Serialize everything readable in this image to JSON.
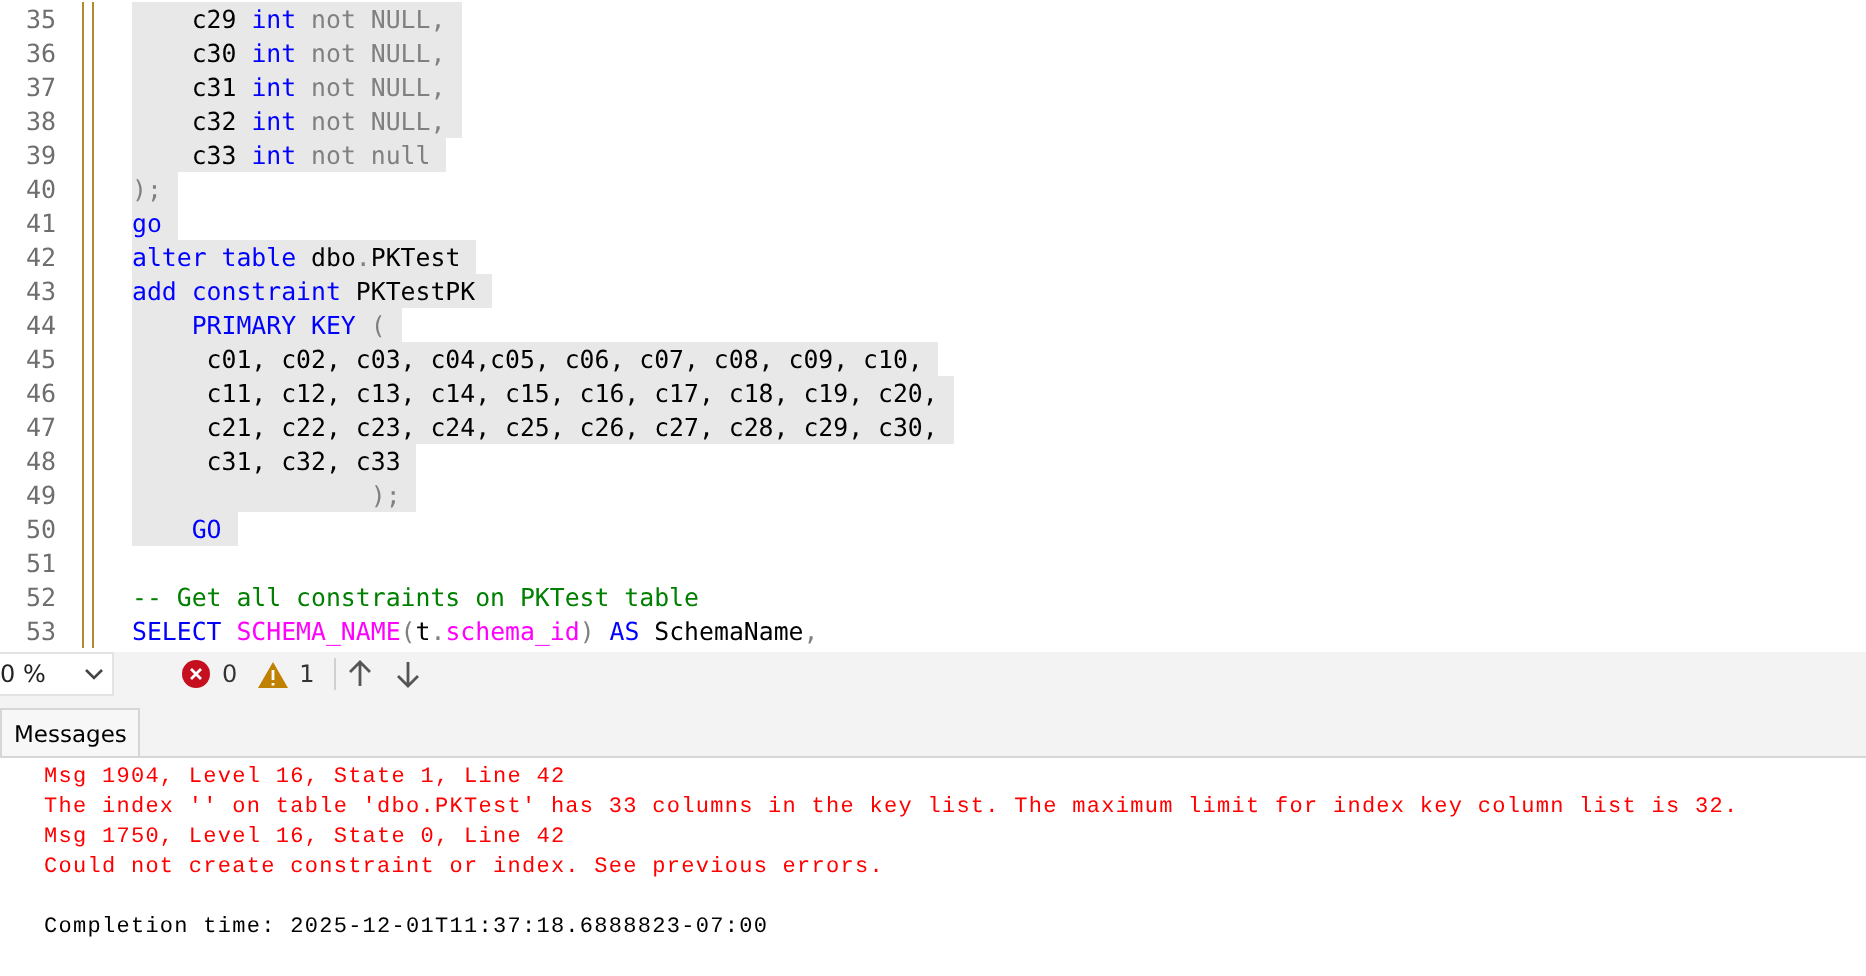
{
  "editor": {
    "lines": [
      {
        "number": "35",
        "selected": true,
        "tokens": [
          {
            "kind": "text",
            "text": "    c29 "
          },
          {
            "kind": "keyword",
            "text": "int"
          },
          {
            "kind": "gray",
            "text": " not NULL,"
          }
        ]
      },
      {
        "number": "36",
        "selected": true,
        "tokens": [
          {
            "kind": "text",
            "text": "    c30 "
          },
          {
            "kind": "keyword",
            "text": "int"
          },
          {
            "kind": "gray",
            "text": " not NULL,"
          }
        ]
      },
      {
        "number": "37",
        "selected": true,
        "tokens": [
          {
            "kind": "text",
            "text": "    c31 "
          },
          {
            "kind": "keyword",
            "text": "int"
          },
          {
            "kind": "gray",
            "text": " not NULL,"
          }
        ]
      },
      {
        "number": "38",
        "selected": true,
        "tokens": [
          {
            "kind": "text",
            "text": "    c32 "
          },
          {
            "kind": "keyword",
            "text": "int"
          },
          {
            "kind": "gray",
            "text": " not NULL,"
          }
        ]
      },
      {
        "number": "39",
        "selected": true,
        "tokens": [
          {
            "kind": "text",
            "text": "    c33 "
          },
          {
            "kind": "keyword",
            "text": "int"
          },
          {
            "kind": "gray",
            "text": " not null"
          }
        ]
      },
      {
        "number": "40",
        "selected": true,
        "tokens": [
          {
            "kind": "gray",
            "text": ");"
          }
        ]
      },
      {
        "number": "41",
        "selected": true,
        "tokens": [
          {
            "kind": "keyword",
            "text": "go"
          }
        ]
      },
      {
        "number": "42",
        "selected": true,
        "tokens": [
          {
            "kind": "keyword",
            "text": "alter table "
          },
          {
            "kind": "text",
            "text": "dbo"
          },
          {
            "kind": "gray",
            "text": "."
          },
          {
            "kind": "text",
            "text": "PKTest"
          }
        ]
      },
      {
        "number": "43",
        "selected": true,
        "tokens": [
          {
            "kind": "keyword",
            "text": "add constraint "
          },
          {
            "kind": "text",
            "text": "PKTestPK"
          }
        ]
      },
      {
        "number": "44",
        "selected": true,
        "tokens": [
          {
            "kind": "keyword",
            "text": "    PRIMARY KEY "
          },
          {
            "kind": "gray",
            "text": "("
          }
        ]
      },
      {
        "number": "45",
        "selected": true,
        "tokens": [
          {
            "kind": "text",
            "text": "     c01, c02, c03, c04,c05, c06, c07, c08, c09, c10,"
          }
        ]
      },
      {
        "number": "46",
        "selected": true,
        "tokens": [
          {
            "kind": "text",
            "text": "     c11, c12, c13, c14, c15, c16, c17, c18, c19, c20,"
          }
        ]
      },
      {
        "number": "47",
        "selected": true,
        "tokens": [
          {
            "kind": "text",
            "text": "     c21, c22, c23, c24, c25, c26, c27, c28, c29, c30,"
          }
        ]
      },
      {
        "number": "48",
        "selected": true,
        "tokens": [
          {
            "kind": "text",
            "text": "     c31, c32, c33"
          }
        ]
      },
      {
        "number": "49",
        "selected": true,
        "tokens": [
          {
            "kind": "gray",
            "text": "                );"
          }
        ]
      },
      {
        "number": "50",
        "selected": true,
        "tokens": [
          {
            "kind": "keyword",
            "text": "    GO"
          }
        ]
      },
      {
        "number": "51"
      },
      {
        "number": "52",
        "selected": false,
        "tokens": [
          {
            "kind": "comment",
            "text": "-- Get all constraints on PKTest table"
          }
        ]
      },
      {
        "number": "53",
        "selected": false,
        "tokens": [
          {
            "kind": "keyword",
            "text": "SELECT "
          },
          {
            "kind": "function",
            "text": "SCHEMA_NAME"
          },
          {
            "kind": "gray",
            "text": "("
          },
          {
            "kind": "text",
            "text": "t"
          },
          {
            "kind": "gray",
            "text": "."
          },
          {
            "kind": "function",
            "text": "schema_id"
          },
          {
            "kind": "gray",
            "text": ")"
          },
          {
            "kind": "keyword",
            "text": " AS "
          },
          {
            "kind": "text",
            "text": "SchemaName"
          },
          {
            "kind": "gray",
            "text": ","
          }
        ]
      }
    ]
  },
  "status_bar": {
    "zoom": "0 %",
    "errors": "0",
    "warnings": "1"
  },
  "tabs": [
    {
      "label": "Messages",
      "selected": true
    }
  ],
  "messages": [
    {
      "kind": "error",
      "text": "Msg 1904, Level 16, State 1, Line 42"
    },
    {
      "kind": "error",
      "text": "The index '' on table 'dbo.PKTest' has 33 columns in the key list. The maximum limit for index key column list is 32."
    },
    {
      "kind": "error",
      "text": "Msg 1750, Level 16, State 0, Line 42"
    },
    {
      "kind": "error",
      "text": "Could not create constraint or index. See previous errors."
    },
    {
      "kind": "blank"
    },
    {
      "kind": "info",
      "text": "Completion time: 2025-12-01T11:37:18.6888823-07:00"
    }
  ]
}
